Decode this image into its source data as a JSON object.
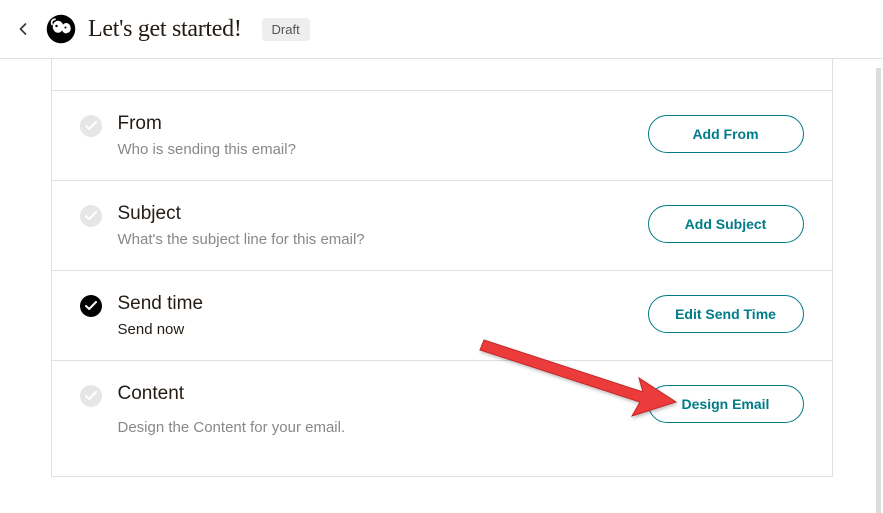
{
  "header": {
    "title": "Let's get started!",
    "badge": "Draft"
  },
  "rows": [
    {
      "title": "From",
      "subtitle": "Who is sending this email?",
      "button": "Add From",
      "complete": false,
      "subdark": false
    },
    {
      "title": "Subject",
      "subtitle": "What's the subject line for this email?",
      "button": "Add Subject",
      "complete": false,
      "subdark": false
    },
    {
      "title": "Send time",
      "subtitle": "Send now",
      "button": "Edit Send Time",
      "complete": true,
      "subdark": true
    },
    {
      "title": "Content",
      "subtitle": "Design the Content for your email.",
      "button": "Design Email",
      "complete": false,
      "subdark": false
    }
  ]
}
